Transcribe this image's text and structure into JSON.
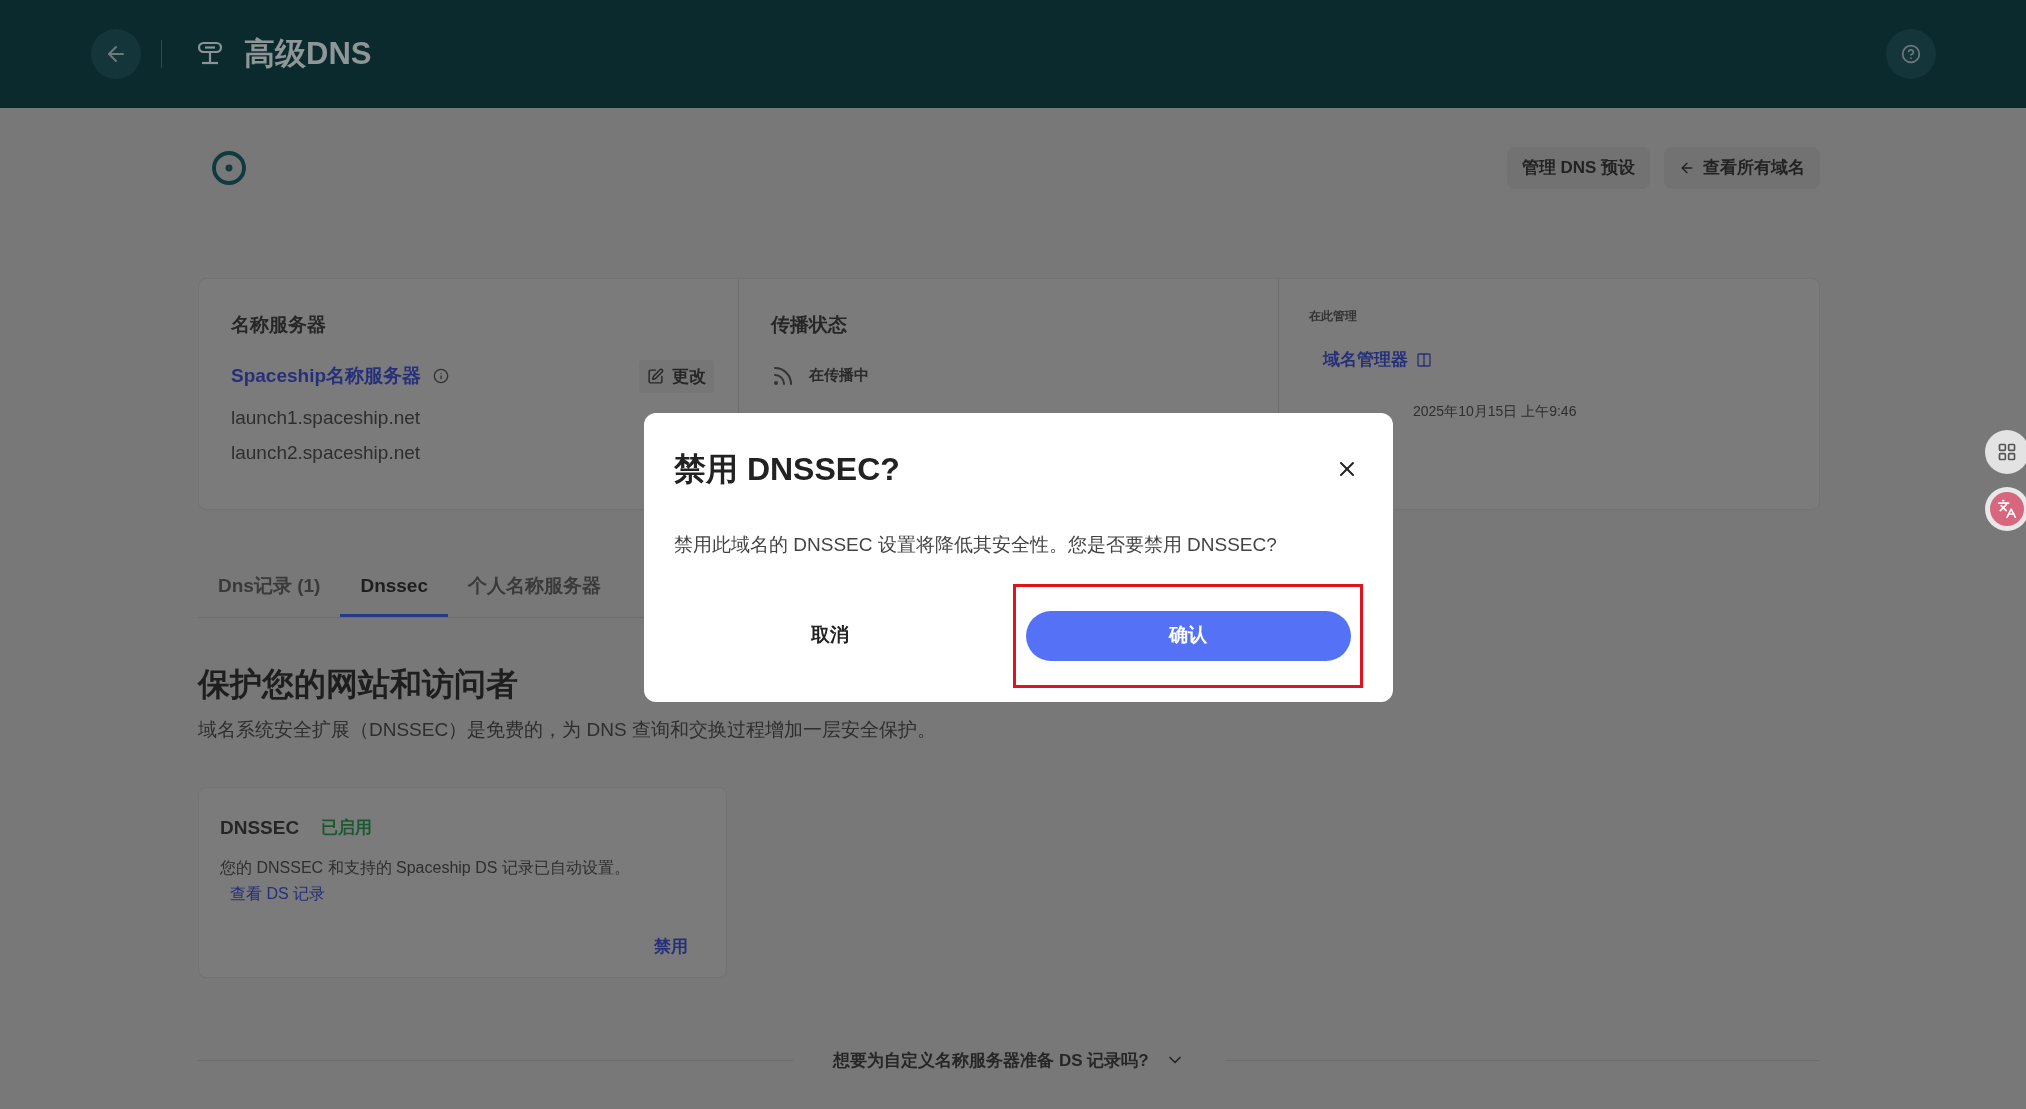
{
  "header": {
    "title": "高级DNS"
  },
  "toolbar": {
    "buttons": [
      {
        "label": "管理 DNS 预设",
        "kind": "plain"
      },
      {
        "label": "查看所有域名",
        "kind": "back"
      }
    ]
  },
  "info": {
    "nameservers": {
      "heading": "名称服务器",
      "provider": "Spaceship名称服务器",
      "edit": "更改",
      "servers": [
        "launch1.spaceship.net",
        "launch2.spaceship.net"
      ]
    },
    "propagation": {
      "heading": "传播状态",
      "status": "在传播中"
    },
    "managed": {
      "heading": "在此管理",
      "link": "域名管理器",
      "updated": "2025年10月15日 上午9:46"
    }
  },
  "tabs": [
    {
      "label": "Dns记录 (1)",
      "selected": false
    },
    {
      "label": "Dnssec",
      "selected": true
    },
    {
      "label": "个人名称服务器",
      "selected": false
    }
  ],
  "section": {
    "heading": "保护您的网站和访问者",
    "description": "域名系统安全扩展（DNSSEC）是免费的，为 DNS 查询和交换过程增加一层安全保护。"
  },
  "dnssec_card": {
    "title": "DNSSEC",
    "status": "已启用",
    "enabled": true,
    "description": "您的 DNSSEC 和支持的 Spaceship DS 记录已自动设置。",
    "link": "查看 DS 记录",
    "action": "禁用"
  },
  "footer_question": "想要为自定义名称服务器准备 DS 记录吗?",
  "dialog": {
    "title": "禁用 DNSSEC?",
    "message": "禁用此域名的 DNSSEC 设置将降低其安全性。您是否要禁用 DNSSEC?",
    "cancel": "取消",
    "confirm": "确认",
    "confirm_highlighted": true
  }
}
